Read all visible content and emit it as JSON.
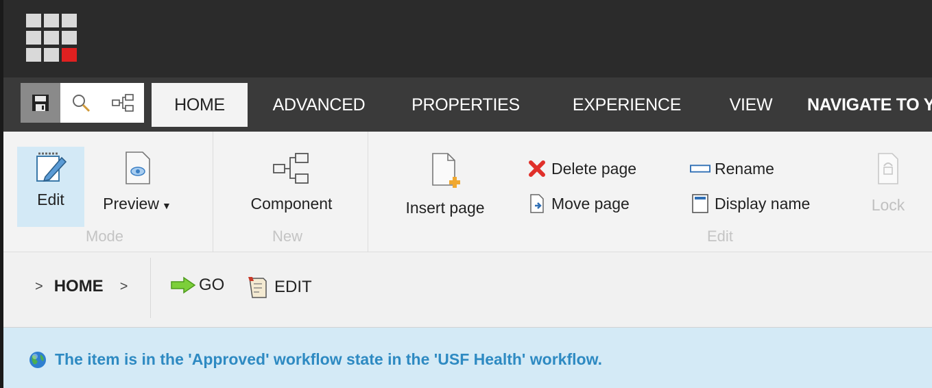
{
  "colors": {
    "topbar": "#2b2b2b",
    "tabrow": "#3a3a3a",
    "ribbon": "#f3f3f3",
    "notify_bg": "#d4eaf6",
    "notify_text": "#2e8ac2",
    "accent_red": "#e02020"
  },
  "launchpad": {
    "icon": "launchpad-grid-icon"
  },
  "quick_actions": [
    {
      "icon": "save-icon"
    },
    {
      "icon": "search-icon"
    },
    {
      "icon": "navigation-tree-icon"
    }
  ],
  "tabs": [
    {
      "label": "HOME",
      "active": true
    },
    {
      "label": "ADVANCED"
    },
    {
      "label": "PROPERTIES"
    },
    {
      "label": "EXPERIENCE"
    },
    {
      "label": "VIEW"
    },
    {
      "label": "NAVIGATE TO Y"
    }
  ],
  "ribbon": {
    "groups": {
      "mode": "Mode",
      "new": "New",
      "edit": "Edit"
    },
    "buttons": {
      "edit": "Edit",
      "preview": "Preview",
      "component": "Component",
      "insert_page": "Insert page",
      "delete_page": "Delete page",
      "move_page": "Move page",
      "rename": "Rename",
      "display_name": "Display name",
      "lock": "Lock"
    }
  },
  "breadcrumb": {
    "home": "HOME",
    "go": "GO",
    "edit": "EDIT"
  },
  "notification": {
    "message": "The item is in the 'Approved' workflow state in the 'USF Health' workflow."
  }
}
